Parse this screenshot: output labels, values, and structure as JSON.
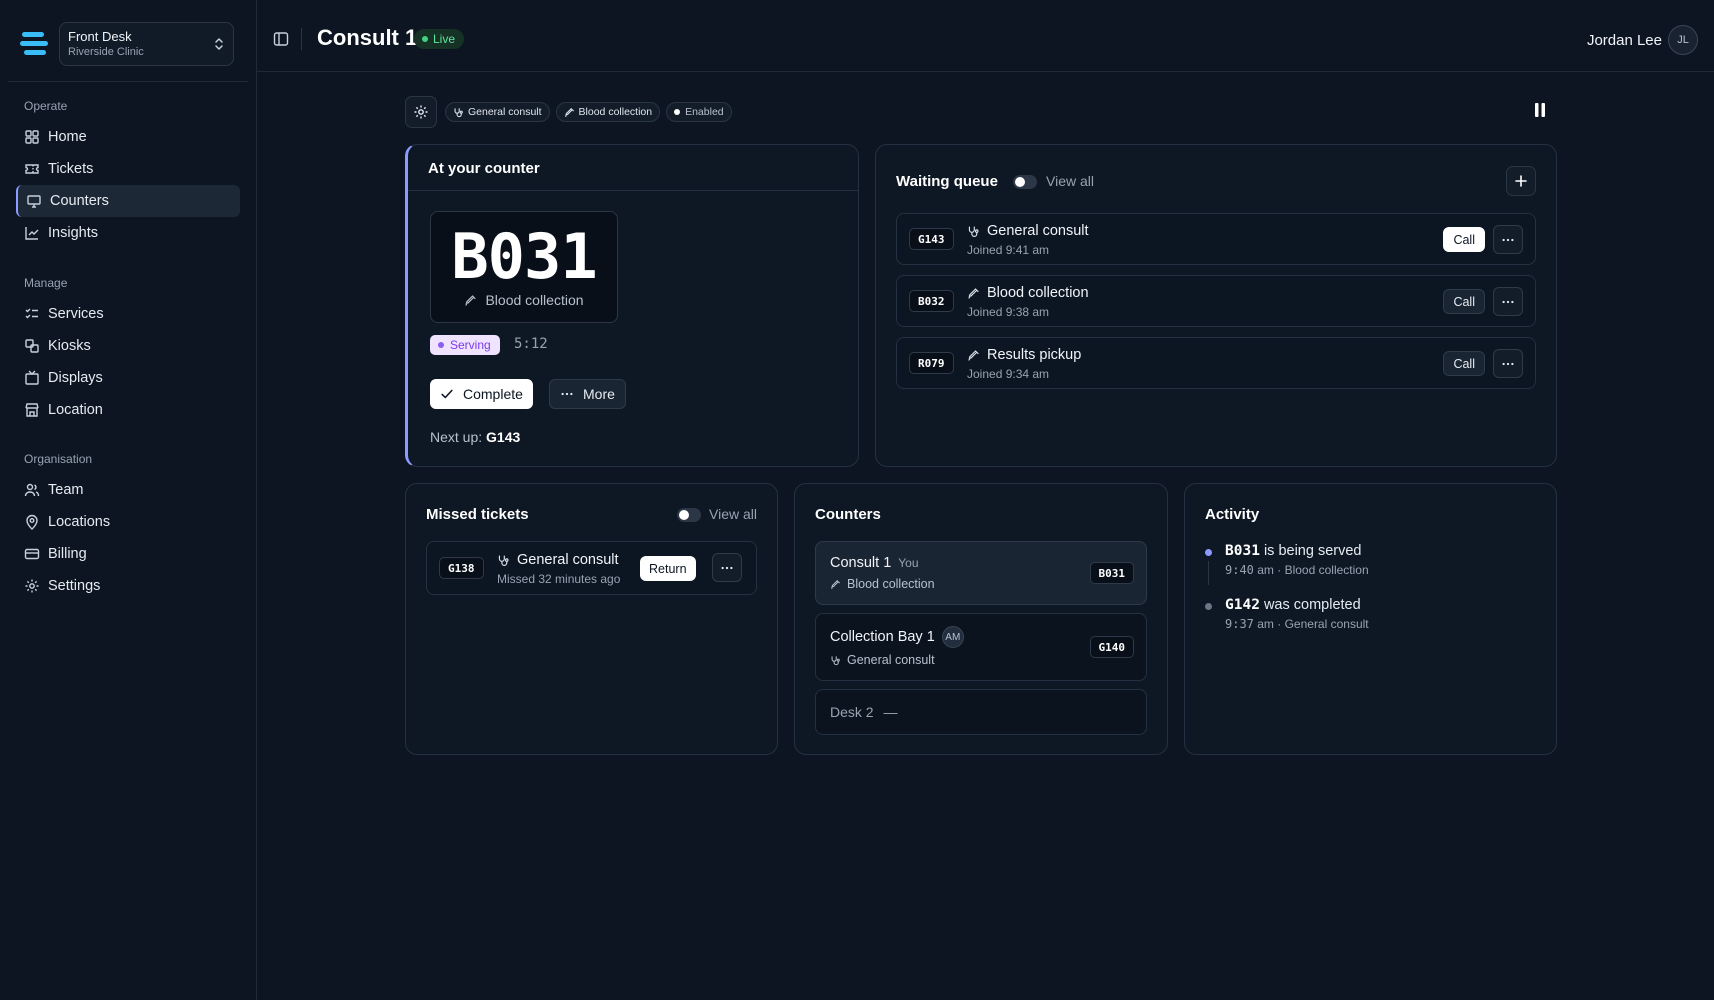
{
  "sidebar": {
    "org_name": "Front Desk",
    "org_sub": "Riverside Clinic",
    "groups": [
      {
        "heading": "Operate",
        "items": [
          "Home",
          "Tickets",
          "Counters",
          "Insights"
        ]
      },
      {
        "heading": "Manage",
        "items": [
          "Services",
          "Kiosks",
          "Displays",
          "Location"
        ]
      },
      {
        "heading": "Organisation",
        "items": [
          "Team",
          "Locations",
          "Billing",
          "Settings"
        ]
      }
    ],
    "active_item": "Counters"
  },
  "header": {
    "title": "Consult 1",
    "status": "Live",
    "user_name": "Jordan Lee",
    "user_initials": "JL"
  },
  "toolbar": {
    "chips": [
      "General consult",
      "Blood collection",
      "Enabled"
    ]
  },
  "counter": {
    "title": "At your counter",
    "ticket": "B031",
    "service": "Blood collection",
    "status": "Serving",
    "elapsed": "5:12",
    "complete_label": "Complete",
    "more_label": "More",
    "next_up_label": "Next up:",
    "next_up_code": "G143"
  },
  "queue": {
    "title": "Waiting queue",
    "view_all": "View all",
    "items": [
      {
        "code": "G143",
        "service": "General consult",
        "joined": "Joined 9:41 am",
        "action": "Call"
      },
      {
        "code": "B032",
        "service": "Blood collection",
        "joined": "Joined 9:38 am",
        "action": "Call"
      },
      {
        "code": "R079",
        "service": "Results pickup",
        "joined": "Joined 9:34 am",
        "action": "Call"
      }
    ]
  },
  "missed": {
    "title": "Missed tickets",
    "view_all": "View all",
    "items": [
      {
        "code": "G138",
        "service": "General consult",
        "missed": "Missed 32 minutes ago",
        "action": "Return"
      }
    ]
  },
  "counters": {
    "title": "Counters",
    "items": [
      {
        "name": "Consult 1",
        "tag": "You",
        "service": "Blood collection",
        "code": "B031"
      },
      {
        "name": "Collection Bay 1",
        "initials": "AM",
        "service": "General consult",
        "code": "G140"
      },
      {
        "name": "Desk 2",
        "empty": "—"
      }
    ]
  },
  "activity": {
    "title": "Activity",
    "items": [
      {
        "code": "B031",
        "text": "is being served",
        "time": "9:40",
        "suffix": "am · Blood collection",
        "dot_color": "#8b9bff"
      },
      {
        "code": "G142",
        "text": "was completed",
        "time": "9:37",
        "suffix": "am · General consult",
        "dot_color": "#6b7686"
      }
    ]
  }
}
